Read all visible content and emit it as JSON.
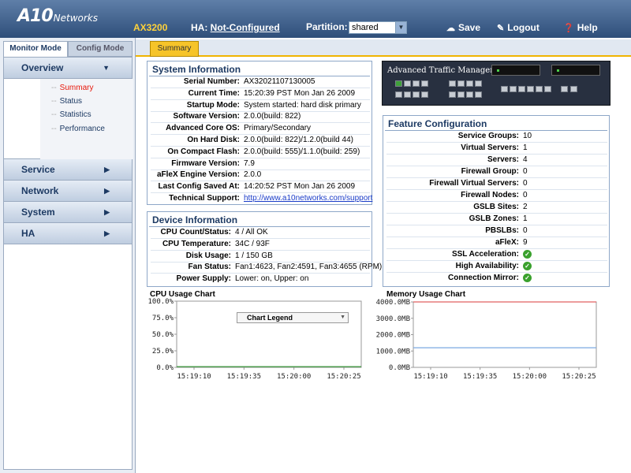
{
  "header": {
    "logo_big": "A10",
    "logo_small": "Networks",
    "model": "AX3200",
    "ha_label": "HA:",
    "ha_value": "Not-Configured",
    "partition_label": "Partition:",
    "partition_value": "shared",
    "save_label": "Save",
    "logout_label": "Logout",
    "help_label": "Help"
  },
  "nav": {
    "mode_tabs": [
      "Monitor Mode",
      "Config Mode"
    ],
    "sections": [
      "Overview",
      "Service",
      "Network",
      "System",
      "HA"
    ],
    "overview_items": [
      "Summary",
      "Status",
      "Statistics",
      "Performance"
    ],
    "selected_item": "Summary"
  },
  "main": {
    "tab": "Summary"
  },
  "system_info": {
    "title": "System Information",
    "rows": [
      {
        "label": "Serial Number:",
        "value": "AX32021107130005"
      },
      {
        "label": "Current Time:",
        "value": "15:20:39 PST Mon Jan 26 2009"
      },
      {
        "label": "Startup Mode:",
        "value": "System started: hard disk primary"
      },
      {
        "label": "Software Version:",
        "value": "2.0.0(build: 822)"
      },
      {
        "label": "Advanced Core OS:",
        "value": "Primary/Secondary"
      },
      {
        "label": "On Hard Disk:",
        "value": "2.0.0(build: 822)/1.2.0(build 44)"
      },
      {
        "label": "On Compact Flash:",
        "value": "2.0.0(build: 555)/1.1.0(build: 259)"
      },
      {
        "label": "Firmware Version:",
        "value": "7.9"
      },
      {
        "label": "aFleX Engine Version:",
        "value": "2.0.0"
      },
      {
        "label": "Last Config Saved At:",
        "value": "14:20:52 PST Mon Jan 26 2009"
      },
      {
        "label": "Technical Support:",
        "value": "http://www.a10networks.com/support"
      }
    ]
  },
  "device_info": {
    "title": "Device Information",
    "rows": [
      {
        "label": "CPU Count/Status:",
        "value": "4 / All OK"
      },
      {
        "label": "CPU Temperature:",
        "value": "34C / 93F"
      },
      {
        "label": "Disk Usage:",
        "value": "1 / 150 GB"
      },
      {
        "label": "Fan Status:",
        "value": "Fan1:4623, Fan2:4591, Fan3:4655 (RPM)"
      },
      {
        "label": "Power Supply:",
        "value": "Lower: on, Upper: on"
      }
    ]
  },
  "atm": {
    "title": "Advanced Traffic Manager"
  },
  "feature_config": {
    "title": "Feature Configuration",
    "rows": [
      {
        "label": "Service Groups:",
        "value": "10"
      },
      {
        "label": "Virtual Servers:",
        "value": "1"
      },
      {
        "label": "Servers:",
        "value": "4"
      },
      {
        "label": "Firewall Group:",
        "value": "0"
      },
      {
        "label": "Firewall Virtual Servers:",
        "value": "0"
      },
      {
        "label": "Firewall Nodes:",
        "value": "0"
      },
      {
        "label": "GSLB Sites:",
        "value": "2"
      },
      {
        "label": "GSLB Zones:",
        "value": "1"
      },
      {
        "label": "PBSLBs:",
        "value": "0"
      },
      {
        "label": "aFleX:",
        "value": "9"
      },
      {
        "label": "SSL Acceleration:",
        "value": "",
        "check": true
      },
      {
        "label": "High Availability:",
        "value": "",
        "check": true
      },
      {
        "label": "Connection Mirror:",
        "value": "",
        "check": true
      }
    ]
  },
  "chart_data": [
    {
      "type": "line",
      "title": "CPU Usage Chart",
      "legend_label": "Chart Legend",
      "x": [
        "15:19:10",
        "15:19:35",
        "15:20:00",
        "15:20:25"
      ],
      "y_ticks": [
        "100.0%",
        "75.0%",
        "50.0%",
        "25.0%",
        "0.0%"
      ],
      "ylim": [
        0,
        100
      ],
      "series": [
        {
          "values": [
            1,
            1,
            1,
            1
          ],
          "color": "#3a9a3a"
        }
      ]
    },
    {
      "type": "line",
      "title": "Memory Usage Chart",
      "x": [
        "15:19:10",
        "15:19:35",
        "15:20:00",
        "15:20:25"
      ],
      "y_ticks": [
        "4000.0MB",
        "3000.0MB",
        "2000.0MB",
        "1000.0MB",
        "0.0MB"
      ],
      "ylim": [
        0,
        4000
      ],
      "series": [
        {
          "values": [
            4000,
            4000,
            4000,
            4000
          ],
          "color": "#e06060"
        },
        {
          "values": [
            1200,
            1200,
            1200,
            1200
          ],
          "color": "#7aa8e0"
        }
      ]
    }
  ]
}
